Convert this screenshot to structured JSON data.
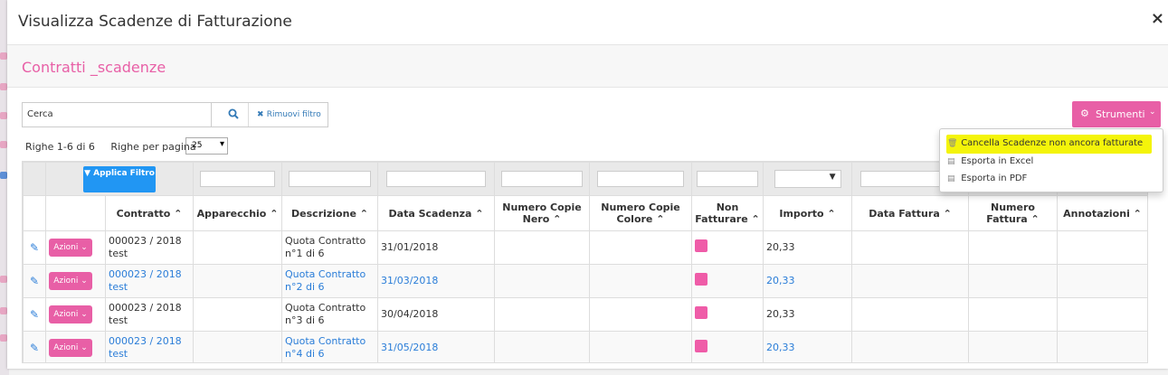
{
  "modal": {
    "title": "Visualizza Scadenze di Fatturazione",
    "close": "×"
  },
  "section": {
    "title": "Contratti _scadenze"
  },
  "search": {
    "value": "Cerca",
    "remove_label": "Rimuovi filtro"
  },
  "pagination": {
    "rows_info": "Righe 1-6 di 6",
    "per_page_label": "Righe per pagina",
    "per_page_value": "25"
  },
  "toolbar": {
    "strumenti_label": "Strumenti"
  },
  "dropdown": {
    "items": [
      {
        "label": "Cancella Scadenze non ancora fatturate",
        "icon": "trash-icon"
      },
      {
        "label": "Esporta in Excel",
        "icon": "excel-file-icon"
      },
      {
        "label": "Esporta in PDF",
        "icon": "pdf-file-icon"
      }
    ]
  },
  "filter": {
    "apply_label": "Applica Filtro"
  },
  "table": {
    "columns": [
      "Contratto",
      "Apparecchio",
      "Descrizione",
      "Data Scadenza",
      "Numero Copie Nero",
      "Numero Copie Colore",
      "Non Fatturare",
      "Importo",
      "Data Fattura",
      "Numero Fattura",
      "Annotazioni"
    ],
    "actions_label": "Azioni",
    "rows": [
      {
        "contratto": "000023 / 2018 test",
        "descrizione": "Quota Contratto n°1 di 6",
        "data": "31/01/2018",
        "importo": "20,33"
      },
      {
        "contratto": "000023 / 2018 test",
        "descrizione": "Quota Contratto n°2 di 6",
        "data": "31/03/2018",
        "importo": "20,33"
      },
      {
        "contratto": "000023 / 2018 test",
        "descrizione": "Quota Contratto n°3 di 6",
        "data": "30/04/2018",
        "importo": "20,33"
      },
      {
        "contratto": "000023 / 2018 test",
        "descrizione": "Quota Contratto n°4 di 6",
        "data": "31/05/2018",
        "importo": "20,33"
      }
    ]
  },
  "colors": {
    "accent": "#e85fa6",
    "primary": "#2196f3",
    "link": "#2a7dd8",
    "highlight": "#f4f40a"
  }
}
